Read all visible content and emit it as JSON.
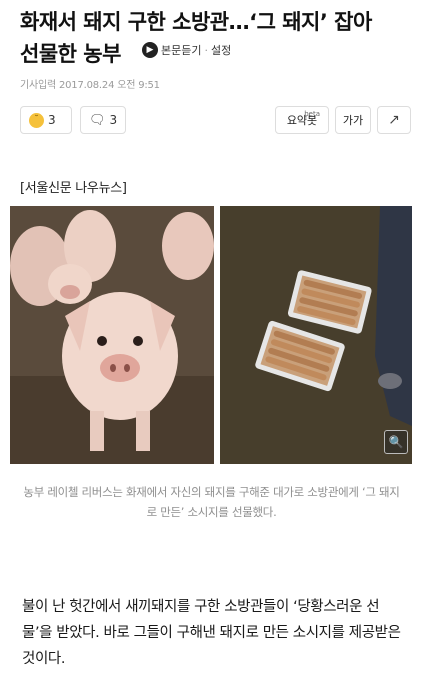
{
  "article": {
    "headline_line1": "화재서 돼지 구한 소방관…‘그 돼지’ 잡아",
    "headline_line2": "선물한 농부",
    "listen_label": "본문듣기",
    "settings_label": "설정",
    "meta": "기사입력 2017.08.24 오전 9:51",
    "source": "[서울신문 나우뉴스]",
    "caption": "농부 레이첼 리버스는 화재에서 자신의 돼지를 구해준 대가로 소방관에게 ‘그 돼지로 만든’ 소시지를 선물했다.",
    "body": "불이 난 헛간에서 새끼돼지를 구한 소방관들이 ‘당황스러운 선물’을 받았다. 바로 그들이 구해낸 돼지로 만든 소시지를 제공받은 것이다."
  },
  "reactions": {
    "sad_count": "3",
    "comment_count": "3"
  },
  "tools": {
    "summary_label": "요약봇",
    "summary_badge": "beta",
    "font_label": "가가"
  },
  "icons": {
    "sad": "sad-face-icon",
    "comment": "comment-bubble-icon",
    "share": "share-icon",
    "speaker": "speaker-icon",
    "zoom": "zoom-icon"
  },
  "colors": {
    "meta_gray": "#9a9a9a",
    "caption_gray": "#8f8f8f",
    "border": "#dddddd",
    "emoji_yellow": "#f5c13b"
  }
}
